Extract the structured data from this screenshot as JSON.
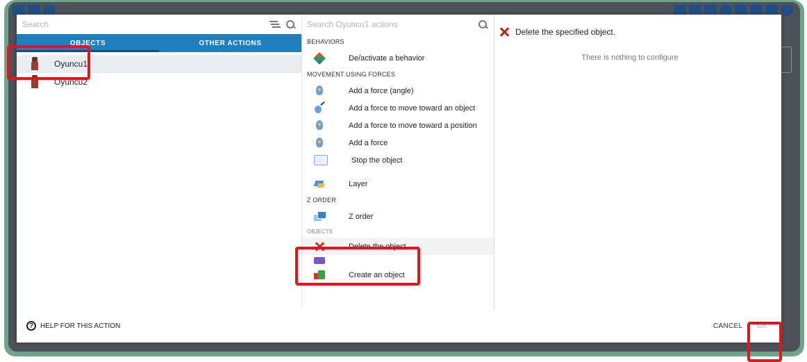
{
  "left_panel": {
    "search_placeholder": "Search",
    "tabs": [
      {
        "label": "OBJECTS"
      },
      {
        "label": "OTHER ACTIONS"
      }
    ],
    "objects": [
      {
        "name": "Oyuncu1"
      },
      {
        "name": "Oyuncu2"
      }
    ]
  },
  "middle_panel": {
    "search_placeholder": "Search Oyuncu1 actions",
    "sections": {
      "behaviors": "BEHAVIORS",
      "movement": "MOVEMENT USING FORCES",
      "zorder": "Z ORDER",
      "objects": "OBJECTS"
    },
    "actions": {
      "deactivate_behavior": "De/activate a behavior",
      "force_angle": "Add a force (angle)",
      "force_toward_object": "Add a force to move toward an object",
      "force_toward_position": "Add a force to move toward a position",
      "add_force": "Add a force",
      "stop_object": "Stop the object",
      "layer": "Layer",
      "z_order": "Z order",
      "delete_object": "Delete the object",
      "create_object": "Create an object"
    }
  },
  "right_panel": {
    "description": "Delete the specified object.",
    "nothing_to_configure": "There is nothing to configure"
  },
  "footer": {
    "help_label": "HELP FOR THIS ACTION",
    "cancel_label": "CANCEL",
    "ok_label": "OK"
  },
  "colors": {
    "tab_bar": "#1f7fbf",
    "highlight_red": "#e2141c",
    "frame_green": "#6ea58a",
    "background_dark": "#4c5258"
  }
}
